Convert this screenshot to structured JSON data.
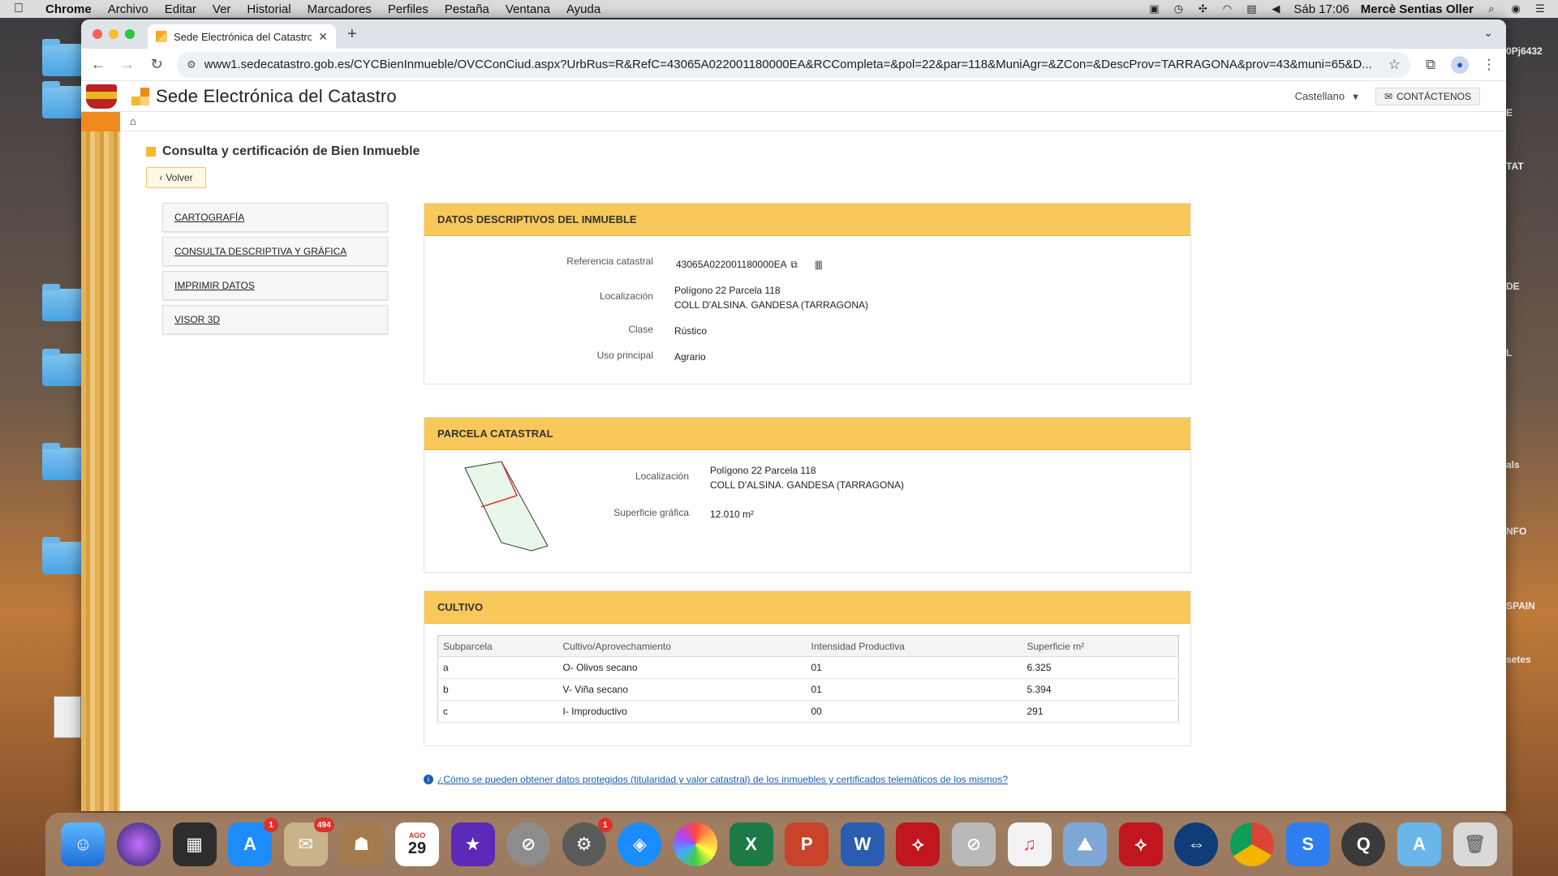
{
  "menubar": {
    "app": "Chrome",
    "items": [
      "Archivo",
      "Editar",
      "Ver",
      "Historial",
      "Marcadores",
      "Perfiles",
      "Pestaña",
      "Ventana",
      "Ayuda"
    ],
    "clock": "Sáb 17:06",
    "user": "Mercè Sentias Oller"
  },
  "desktop": {
    "right_labels": [
      "0Pj6432",
      "E",
      "TAT",
      "DE",
      "L",
      "als",
      "NFO",
      "SPAIN",
      "setes"
    ]
  },
  "browser": {
    "tab_title": "Sede Electrónica del Catastro",
    "url": "www1.sedecatastro.gob.es/CYCBienInmueble/OVCConCiud.aspx?UrbRus=R&RefC=43065A022001180000EA&RCCompleta=&pol=22&par=118&MuniAgr=&ZCon=&DescProv=TARRAGONA&prov=43&muni=65&D..."
  },
  "site": {
    "title": "Sede Electrónica del Catastro",
    "language": "Castellano",
    "contact": "CONTÁCTENOS"
  },
  "page": {
    "heading": "Consulta y certificación de Bien Inmueble",
    "back_label": "Volver",
    "menu": [
      "CARTOGRAFÍA",
      "CONSULTA DESCRIPTIVA Y GRÁFICA",
      "IMPRIMIR DATOS",
      "VISOR 3D"
    ]
  },
  "datos": {
    "title": "DATOS DESCRIPTIVOS DEL INMUEBLE",
    "ref_label": "Referencia catastral",
    "ref_value": "43065A022001180000EA",
    "loc_label": "Localización",
    "loc_line1": "Polígono 22 Parcela 118",
    "loc_line2": "COLL D'ALSINA. GANDESA (TARRAGONA)",
    "clase_label": "Clase",
    "clase_value": "Rústico",
    "uso_label": "Uso principal",
    "uso_value": "Agrario"
  },
  "parcela": {
    "title": "PARCELA CATASTRAL",
    "loc_label": "Localización",
    "loc_line1": "Polígono 22 Parcela 118",
    "loc_line2": "COLL D'ALSINA. GANDESA (TARRAGONA)",
    "sup_label": "Superficie gráfica",
    "sup_value": "12.010 m²"
  },
  "cultivo": {
    "title": "CULTIVO",
    "headers": [
      "Subparcela",
      "Cultivo/Aprovechamiento",
      "Intensidad Productiva",
      "Superficie m²"
    ],
    "rows": [
      [
        "a",
        "O- Olivos secano",
        "01",
        "6.325"
      ],
      [
        "b",
        "V- Viña secano",
        "01",
        "5.394"
      ],
      [
        "c",
        "I- Improductivo",
        "00",
        "291"
      ]
    ]
  },
  "help_link": "¿Cómo se pueden obtener datos protegidos (titularidad y valor catastral) de los inmuebles y certificados telemáticos de los mismos?",
  "dock": {
    "badges": {
      "appstore": "1",
      "mail": "494",
      "settings": "1"
    },
    "calendar_month": "AGO",
    "calendar_day": "29"
  }
}
